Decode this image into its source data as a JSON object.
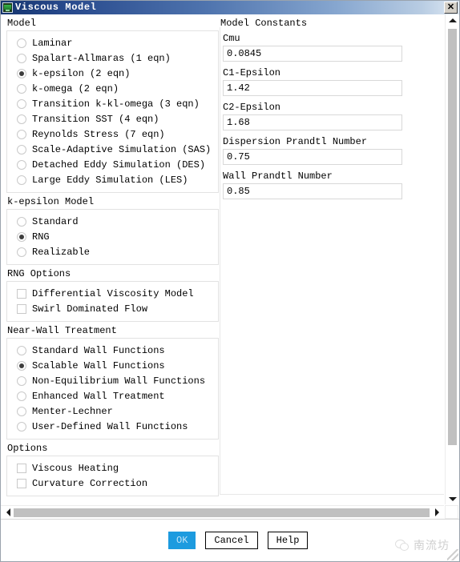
{
  "window": {
    "title": "Viscous Model",
    "icon": "app-icon",
    "close_label": "✕"
  },
  "model_group": {
    "label": "Model",
    "selected": "k-epsilon (2 eqn)",
    "options": [
      "Laminar",
      "Spalart-Allmaras (1 eqn)",
      "k-epsilon (2 eqn)",
      "k-omega (2 eqn)",
      "Transition k-kl-omega (3 eqn)",
      "Transition SST (4 eqn)",
      "Reynolds Stress (7 eqn)",
      "Scale-Adaptive Simulation (SAS)",
      "Detached Eddy Simulation (DES)",
      "Large Eddy Simulation (LES)"
    ]
  },
  "ke_model_group": {
    "label": "k-epsilon Model",
    "selected": "RNG",
    "options": [
      "Standard",
      "RNG",
      "Realizable"
    ]
  },
  "rng_options_group": {
    "label": "RNG Options",
    "options": [
      {
        "label": "Differential Viscosity Model",
        "checked": false
      },
      {
        "label": "Swirl Dominated Flow",
        "checked": false
      }
    ]
  },
  "near_wall_group": {
    "label": "Near-Wall Treatment",
    "selected": "Scalable Wall Functions",
    "options": [
      "Standard Wall Functions",
      "Scalable Wall Functions",
      "Non-Equilibrium Wall Functions",
      "Enhanced Wall Treatment",
      "Menter-Lechner",
      "User-Defined Wall Functions"
    ]
  },
  "options_group": {
    "label": "Options",
    "options": [
      {
        "label": "Viscous Heating",
        "checked": false
      },
      {
        "label": "Curvature Correction",
        "checked": false
      }
    ]
  },
  "model_constants": {
    "label": "Model Constants",
    "fields": [
      {
        "label": "Cmu",
        "value": "0.0845"
      },
      {
        "label": "C1-Epsilon",
        "value": "1.42"
      },
      {
        "label": "C2-Epsilon",
        "value": "1.68"
      },
      {
        "label": "Dispersion Prandtl Number",
        "value": "0.75"
      },
      {
        "label": "Wall Prandtl Number",
        "value": "0.85"
      }
    ]
  },
  "footer": {
    "ok_label": "OK",
    "cancel_label": "Cancel",
    "help_label": "Help",
    "watermark_text": "南流坊"
  },
  "colors": {
    "titlebar_start": "#16356f",
    "titlebar_end": "#dfe9f4",
    "primary_button": "#1d9bdf",
    "scroll_thumb": "#c0c0c0",
    "group_border": "#e2e2e2"
  }
}
